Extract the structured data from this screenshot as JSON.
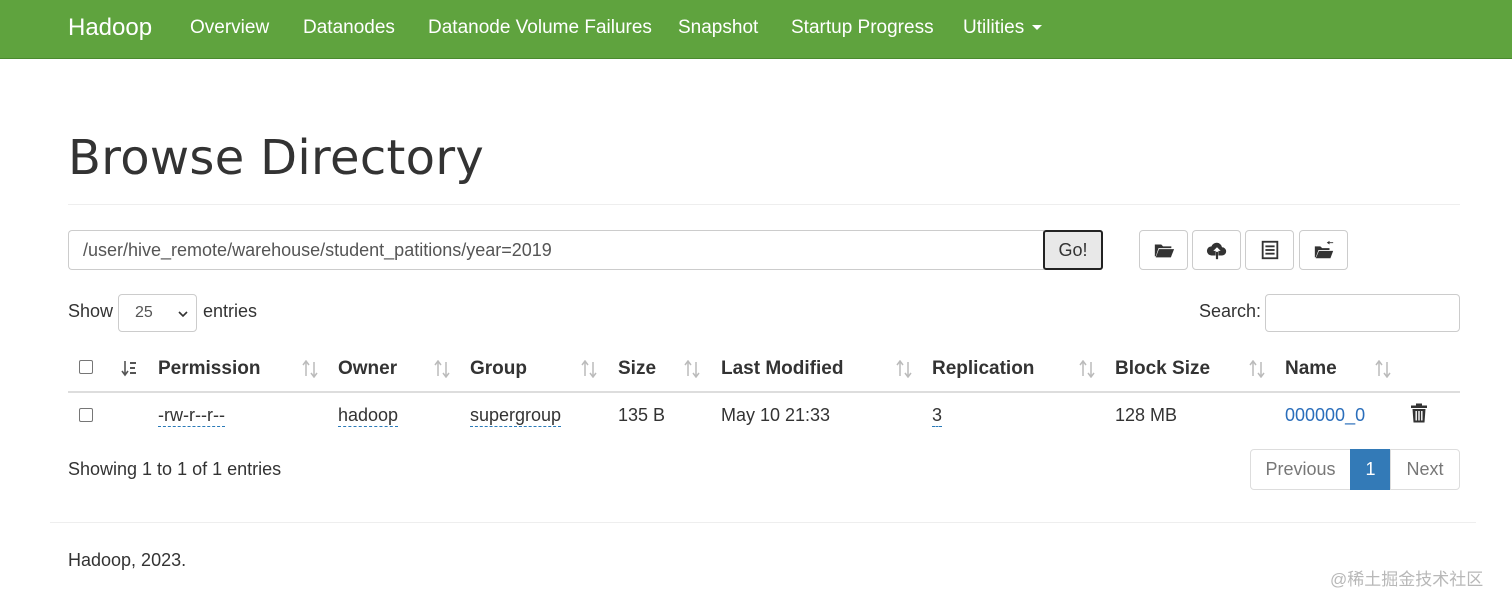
{
  "navbar": {
    "brand": "Hadoop",
    "items": [
      "Overview",
      "Datanodes",
      "Datanode Volume Failures",
      "Snapshot",
      "Startup Progress",
      "Utilities"
    ]
  },
  "page_title": "Browse Directory",
  "path_bar": {
    "value": "/user/hive_remote/warehouse/student_patitions/year=2019",
    "go_label": "Go!"
  },
  "toolbar_icons": [
    "create-directory-icon",
    "upload-icon",
    "cut-paste-icon",
    "folder-move-icon"
  ],
  "entries": {
    "show_label": "Show",
    "selected": "25",
    "suffix_label": "entries",
    "search_label": "Search:",
    "search_value": ""
  },
  "table": {
    "columns": [
      "Permission",
      "Owner",
      "Group",
      "Size",
      "Last Modified",
      "Replication",
      "Block Size",
      "Name"
    ],
    "rows": [
      {
        "permission": "-rw-r--r--",
        "owner": "hadoop",
        "group": "supergroup",
        "size": "135 B",
        "last_modified": "May 10 21:33",
        "replication": "3",
        "block_size": "128 MB",
        "name": "000000_0"
      }
    ]
  },
  "pagination": {
    "info": "Showing 1 to 1 of 1 entries",
    "previous": "Previous",
    "current": "1",
    "next": "Next"
  },
  "footer": {
    "copyright": "Hadoop, 2023."
  },
  "watermark": "@稀土掘金技术社区",
  "colors": {
    "navbar": "#5fa33e",
    "link": "#2a6ebb",
    "active_page": "#337ab7"
  }
}
